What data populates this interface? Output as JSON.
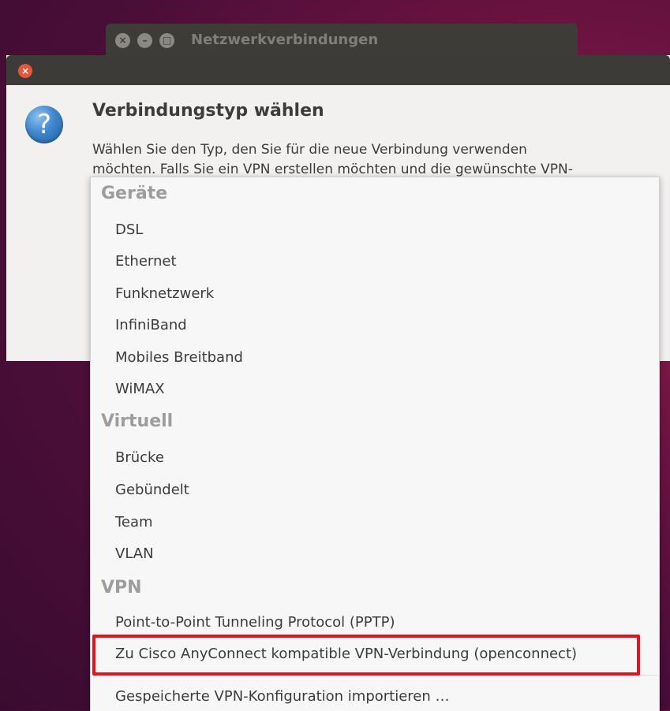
{
  "background_window": {
    "title": "Netzwerkverbindungen",
    "buttons": [
      "close",
      "minimize",
      "maximize"
    ]
  },
  "dialog": {
    "heading": "Verbindungstyp wählen",
    "text_line1": "Wählen Sie den Typ, den Sie für die neue Verbindung verwenden",
    "text_line2": "möchten. Falls Sie ein VPN erstellen möchten und die gewünschte VPN-"
  },
  "menu": {
    "sections": [
      {
        "title": "Geräte",
        "items": [
          "DSL",
          "Ethernet",
          "Funknetzwerk",
          "InfiniBand",
          "Mobiles Breitband",
          "WiMAX"
        ]
      },
      {
        "title": "Virtuell",
        "items": [
          "Brücke",
          "Gebündelt",
          "Team",
          "VLAN"
        ]
      },
      {
        "title": "VPN",
        "items": [
          "Point-to-Point Tunneling Protocol (PPTP)",
          "Zu Cisco AnyConnect kompatible VPN-Verbindung (openconnect)"
        ]
      }
    ],
    "import_item": "Gespeicherte VPN-Konfiguration importieren …"
  },
  "colors": {
    "highlight": "#e0141e",
    "close_button": "#e4573c",
    "question_icon": "#3f86cc"
  }
}
